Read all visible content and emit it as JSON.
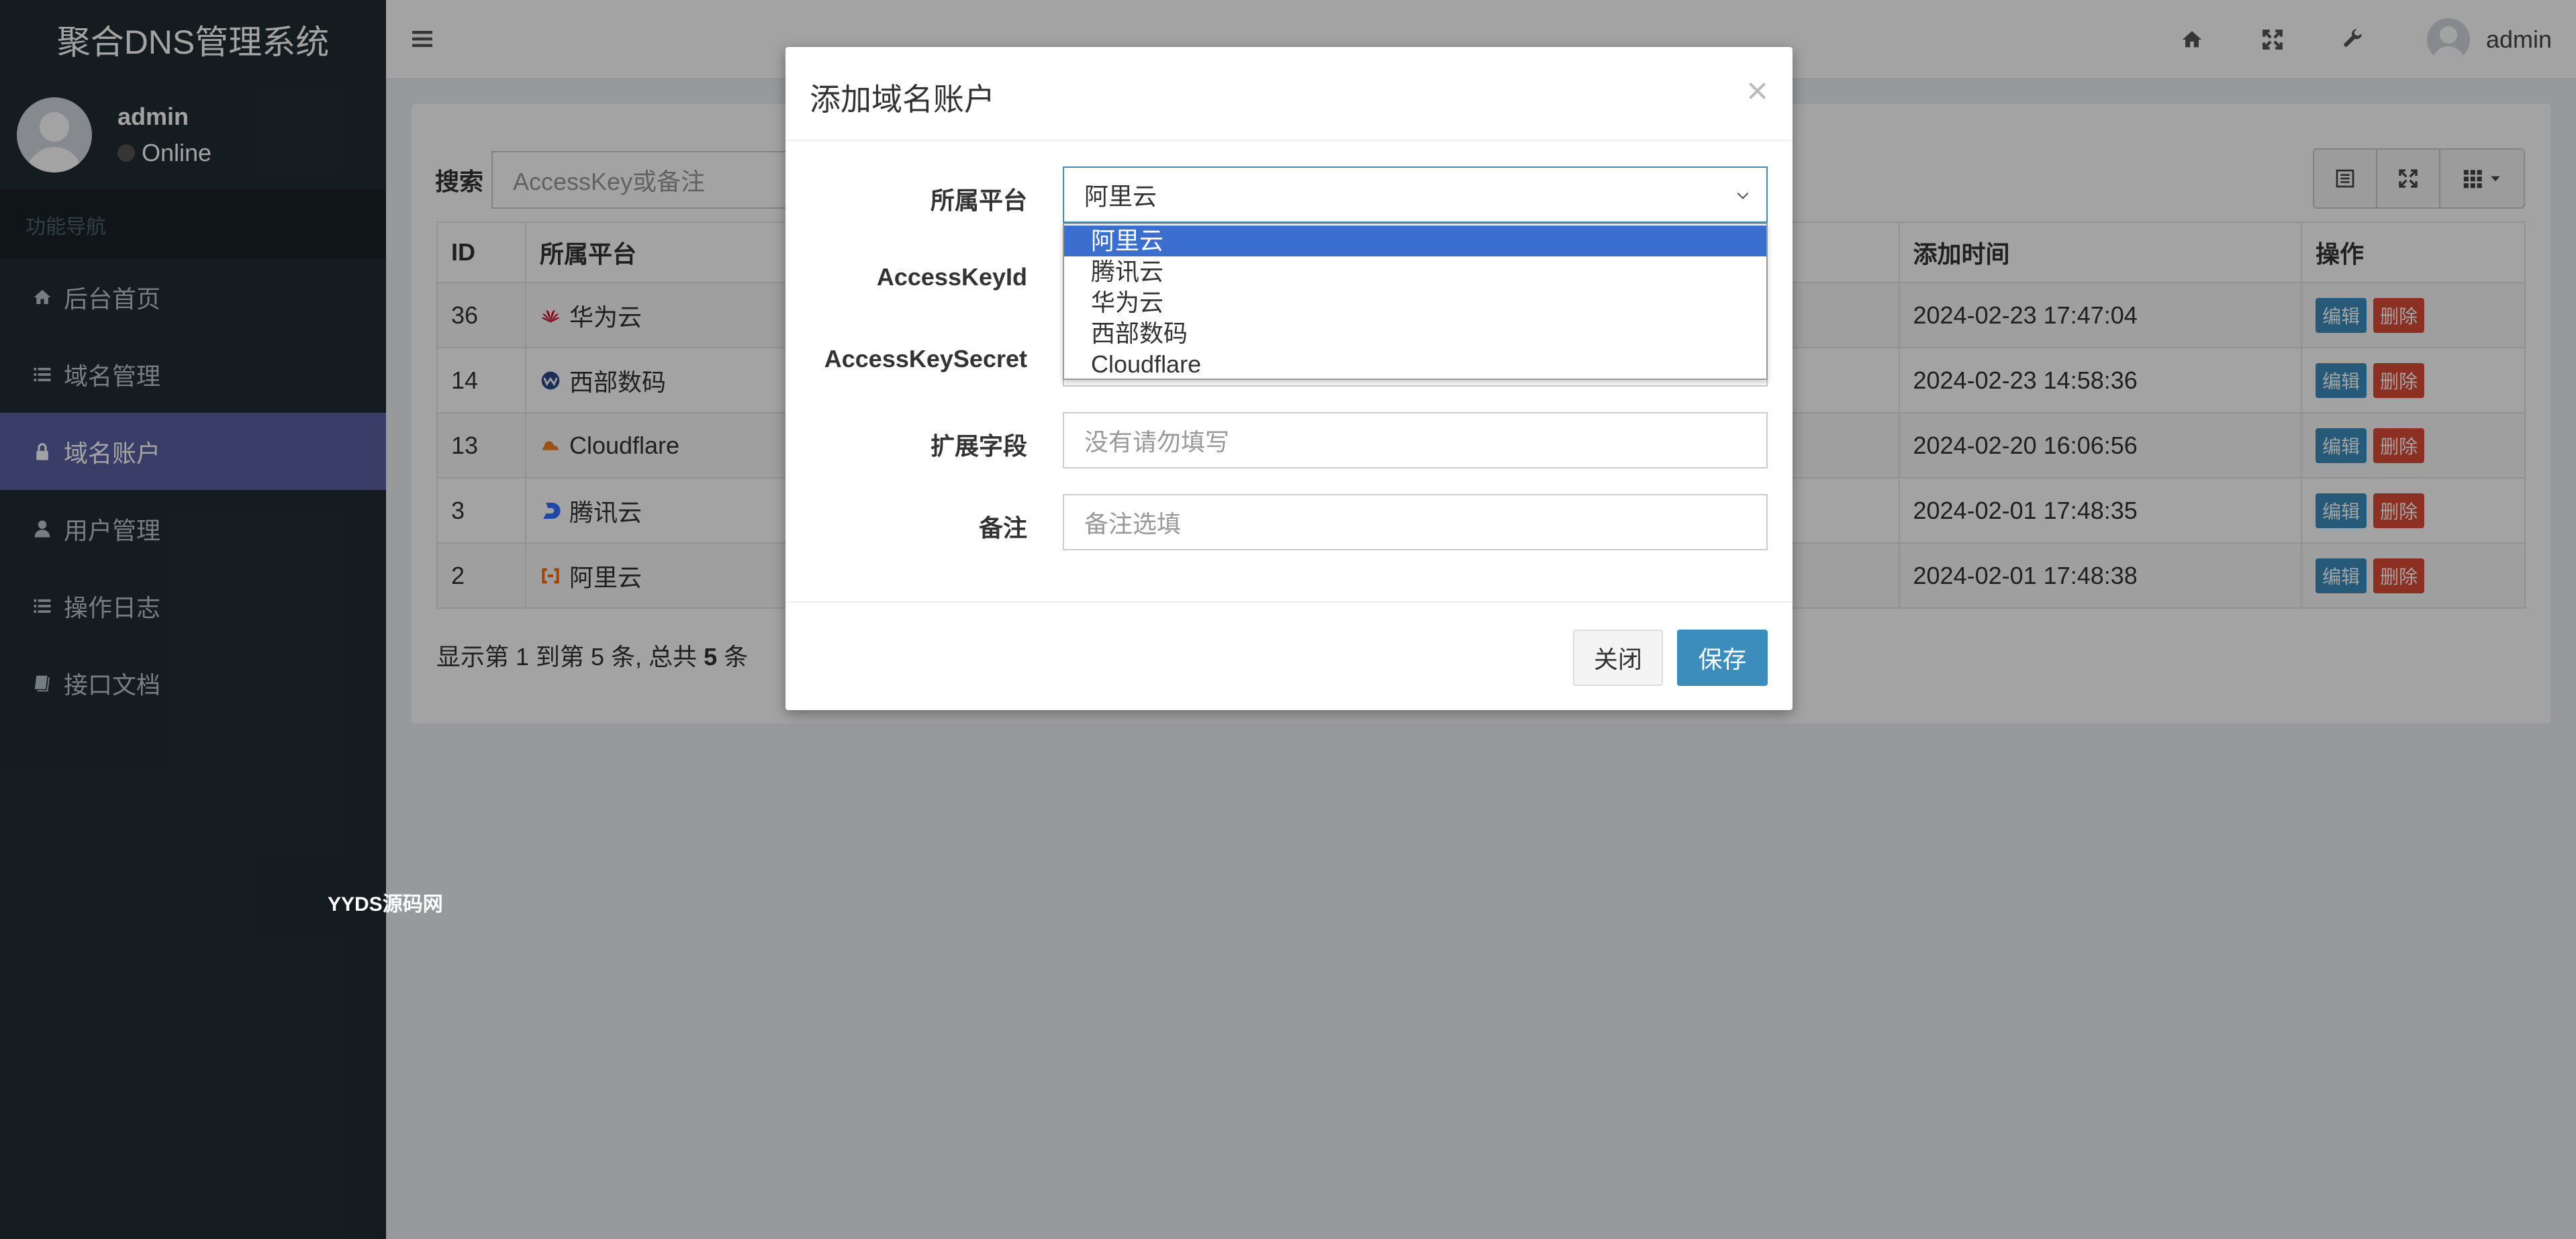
{
  "app": {
    "title": "聚合DNS管理系统"
  },
  "user": {
    "name": "admin",
    "status": "Online"
  },
  "nav": {
    "header": "功能导航",
    "items": [
      {
        "label": "后台首页",
        "icon": "home-icon"
      },
      {
        "label": "域名管理",
        "icon": "list-icon"
      },
      {
        "label": "域名账户",
        "icon": "lock-icon",
        "active": true
      },
      {
        "label": "用户管理",
        "icon": "user-icon"
      },
      {
        "label": "操作日志",
        "icon": "list-icon"
      },
      {
        "label": "接口文档",
        "icon": "book-icon"
      }
    ]
  },
  "topbar": {
    "user_name": "admin"
  },
  "watermark": "YYDS源码网",
  "search": {
    "label": "搜索",
    "placeholder": "AccessKey或备注"
  },
  "table": {
    "headers": [
      "ID",
      "所属平台",
      "添加时间",
      "操作"
    ],
    "rows": [
      {
        "id": "36",
        "platform": "华为云",
        "time": "2024-02-23 17:47:04"
      },
      {
        "id": "14",
        "platform": "西部数码",
        "time": "2024-02-23 14:58:36"
      },
      {
        "id": "13",
        "platform": "Cloudflare",
        "time": "2024-02-20 16:06:56"
      },
      {
        "id": "3",
        "platform": "腾讯云",
        "time": "2024-02-01 17:48:35"
      },
      {
        "id": "2",
        "platform": "阿里云",
        "time": "2024-02-01 17:48:38"
      }
    ],
    "edit_label": "编辑",
    "delete_label": "删除"
  },
  "pager": {
    "prefix": "显示第 1 到第 5 条, 总共 ",
    "total": "5",
    "suffix": " 条"
  },
  "modal": {
    "title": "添加域名账户",
    "close_symbol": "×",
    "labels": {
      "platform": "所属平台",
      "access_key_id": "AccessKeyId",
      "access_key_secret": "AccessKeySecret",
      "extra": "扩展字段",
      "remark": "备注"
    },
    "platform_value": "阿里云",
    "extra_placeholder": "没有请勿填写",
    "remark_placeholder": "备注选填",
    "platform_options": [
      "阿里云",
      "腾讯云",
      "华为云",
      "西部数码",
      "Cloudflare"
    ],
    "close_button": "关闭",
    "save_button": "保存"
  },
  "colors": {
    "sidebar": "#222d32",
    "active_nav": "#5a62a4",
    "primary": "#3c8dbc",
    "danger": "#dd4b39",
    "dropdown_selected": "#3a6fd0"
  }
}
